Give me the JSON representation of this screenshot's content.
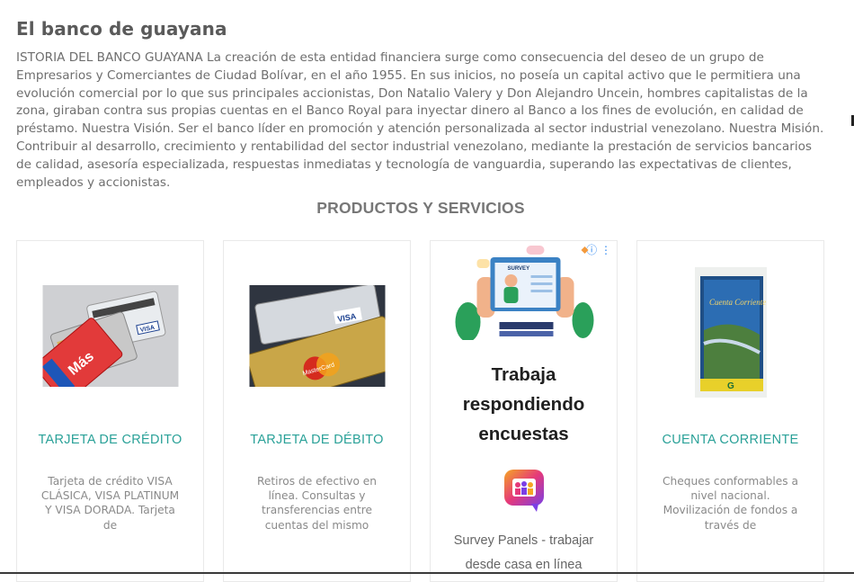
{
  "page": {
    "title": "El banco de guayana",
    "intro": "ISTORIA DEL BANCO GUAYANA La creación de esta entidad financiera surge como consecuencia del deseo de un grupo de Empresarios y Comerciantes de Ciudad Bolívar, en el año 1955. En sus inicios, no poseía un capital activo que le permitiera una evolución comercial por lo que sus principales accionistas, Don Natalio Valery y Don Alejandro Uncein, hombres capitalistas de la zona, giraban contra sus propias cuentas en el Banco Royal para inyectar dinero al Banco a los fines de evolución, en calidad de préstamo. Nuestra Visión. Ser el banco líder en promoción y atención personalizada al sector industrial venezolano. Nuestra Misión. Contribuir al desarrollo, crecimiento y rentabilidad del sector industrial venezolano, mediante la prestación de servicios bancarios de calidad, asesoría especializada, respuestas inmediatas y tecnología de vanguardia, superando las expectativas de clientes, empleados y accionistas."
  },
  "products": {
    "section_title": "PRODUCTOS Y SERVICIOS",
    "cards": [
      {
        "title": "TARJETA DE CRÉDITO",
        "description": "Tarjeta de crédito VISA CLÁSICA, VISA PLATINUM Y VISA DORADA. Tarjeta de",
        "image_labels": [
          "Más",
          "VISA"
        ]
      },
      {
        "title": "TARJETA DE DÉBITO",
        "description": "Retiros de efectivo en línea. Consultas y transferencias entre cuentas del mismo",
        "image_labels": [
          "VISA",
          "MasterCard"
        ]
      },
      {
        "title": "CUENTA CORRIENTE",
        "description": "Cheques conformables a nivel nacional. Movilización de fondos a través de",
        "image_labels": [
          "Cuenta Corriente",
          "G"
        ]
      }
    ]
  },
  "ad": {
    "survey_label": "SURVEY",
    "headline_lines": [
      "Trabaja",
      "respondiendo",
      "encuestas"
    ],
    "caption_lines": [
      "Survey Panels - trabajar",
      "desde casa en línea"
    ],
    "info_icon": "info-icon",
    "menu_icon": "kebab-menu-icon"
  }
}
